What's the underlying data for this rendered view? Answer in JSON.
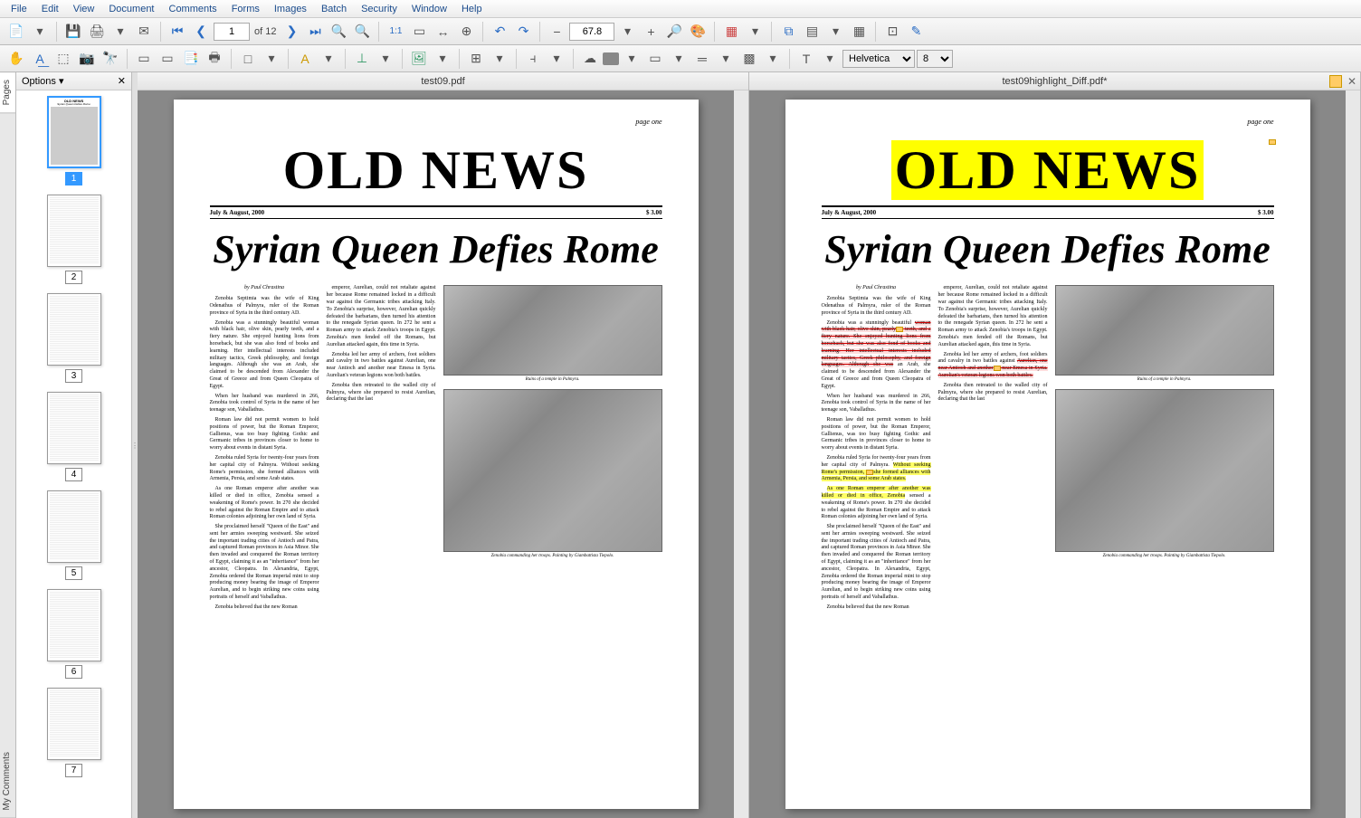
{
  "menu": [
    "File",
    "Edit",
    "View",
    "Document",
    "Comments",
    "Forms",
    "Images",
    "Batch",
    "Security",
    "Window",
    "Help"
  ],
  "toolbar": {
    "page_input": "1",
    "page_count": "of 12",
    "zoom": "67.8",
    "font": "Helvetica",
    "font_size": "8"
  },
  "thumbs": {
    "options": "Options ▾",
    "pages": [
      1,
      2,
      3,
      4,
      5,
      6,
      7
    ]
  },
  "docs": {
    "left": "test09.pdf",
    "right": "test09highlight_Diff.pdf*"
  },
  "sidebar": {
    "tab1": "Pages",
    "tab2": "My Comments"
  },
  "article": {
    "page_label": "page one",
    "title": "OLD NEWS",
    "date": "July & August, 2000",
    "price": "$ 3.00",
    "headline": "Syrian Queen Defies Rome",
    "byline": "by Paul Chrastina",
    "p1": "Zenobia Septimia was the wife of King Odenathus of Palmyra, ruler of the Roman province of Syria in the third century AD.",
    "p2": "Zenobia was a stunningly beautiful woman with black hair, olive skin, pearly teeth, and a fiery nature. She enjoyed hunting lions from horseback, but she was also fond of books and learning. Her intellectual interests included military tactics, Greek philosophy, and foreign languages. Although she was an Arab, she claimed to be descended from Alexander the Great of Greece and from Queen Cleopatra of Egypt.",
    "p3": "When her husband was murdered in 266, Zenobia took control of Syria in the name of her teenage son, Vaballathus.",
    "p4": "Roman law did not permit women to hold positions of power, but the Roman Emperor, Gallienus, was too busy fighting Gothic and Germanic tribes in provinces closer to home to worry about events in distant Syria.",
    "p5": "Zenobia ruled Syria for twenty-four years from her capital city of Palmyra. Without seeking Rome's permission, she formed alliances with Armenia, Persia, and some Arab states.",
    "p6": "As one Roman emperor after another was killed or died in office, Zenobia sensed a weakening of Rome's power. In 270 she decided to rebel against the Roman Empire and to attack Roman colonies adjoining her own land of Syria.",
    "p7": "She proclaimed herself \"Queen of the East\" and sent her armies sweeping westward. She seized the important trading cities of Antioch and Patra, and captured Roman provinces in Asia Minor. She then invaded and conquered the Roman territory of Egypt, claiming it as an \"inheritance\" from her ancestor, Cleopatra. In Alexandria, Egypt, Zenobia ordered the Roman imperial mint to stop producing money bearing the image of Emperor Aurelian, and to begin striking new coins using portraits of herself and Vaballathus.",
    "p8": "Zenobia believed that the new Roman",
    "c2p1": "emperor, Aurelian, could not retaliate against her because Rome remained locked in a difficult war against the Germanic tribes attacking Italy. To Zenobia's surprise, however, Aurelian quickly defeated the barbarians, then turned his attention to the renegade Syrian queen. In 272 he sent a Roman army to attack Zenobia's troops in Egypt. Zenobia's men fended off the Romans, but Aurelian attacked again, this time in Syria.",
    "c2p2": "Zenobia led her army of archers, foot soldiers and cavalry in two battles against Aurelian, one near Antioch and another near Emesa in Syria. Aurelian's veteran legions won both battles.",
    "c2p3": "Zenobia then retreated to the walled city of Palmyra, where she prepared to resist Aurelian, declaring that the last",
    "cap1": "Ruins of a temple in Palmyra.",
    "cap2": "Zenobia commanding her troops. Painting by Giambattista Tiepolo."
  }
}
